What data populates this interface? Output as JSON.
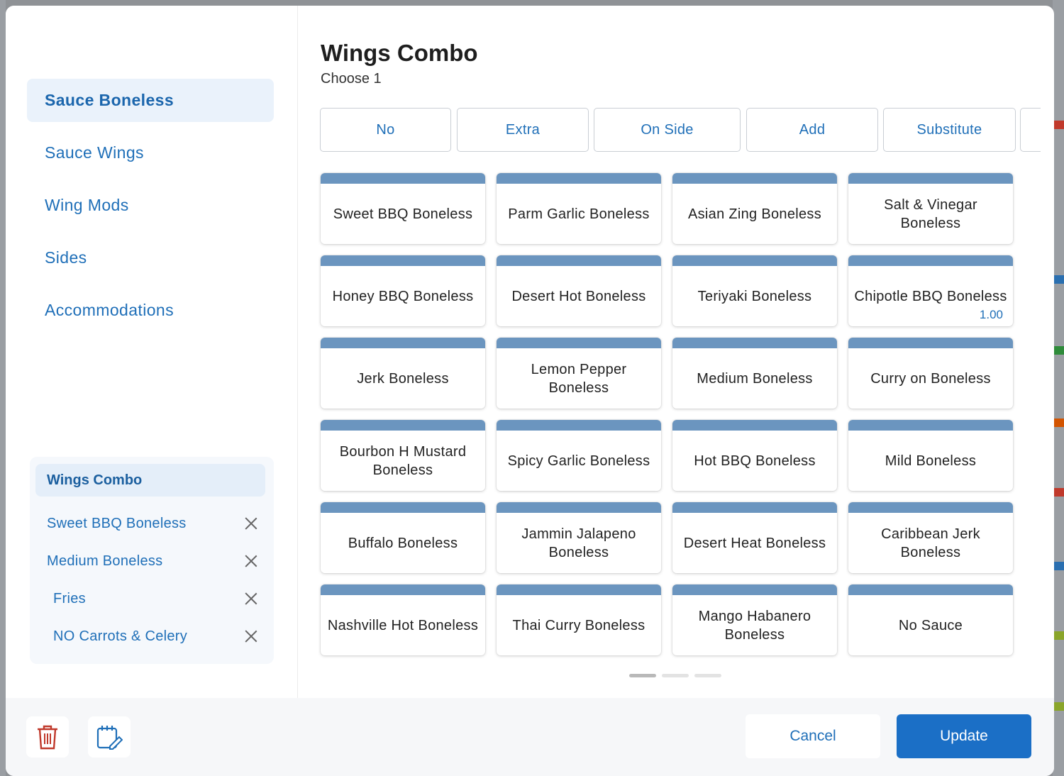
{
  "colors": {
    "accent": "#1f6fb8",
    "tile_bar": "#6b95bf",
    "update_button": "#1b6fc6",
    "delete_icon": "#c0392b"
  },
  "dialog": {
    "title": "Wings Combo",
    "subtitle": "Choose 1"
  },
  "sidebar": {
    "items": [
      {
        "label": "Sauce Boneless",
        "active": true
      },
      {
        "label": "Sauce Wings",
        "active": false
      },
      {
        "label": "Wing Mods",
        "active": false
      },
      {
        "label": "Sides",
        "active": false
      },
      {
        "label": "Accommodations",
        "active": false
      }
    ]
  },
  "summary": {
    "title": "Wings Combo",
    "items": [
      {
        "label": "Sweet BBQ Boneless"
      },
      {
        "label": "Medium Boneless"
      },
      {
        "label": "Fries"
      },
      {
        "label": "NO Carrots & Celery"
      }
    ]
  },
  "modifiers": [
    {
      "label": "No"
    },
    {
      "label": "Extra"
    },
    {
      "label": "On Side"
    },
    {
      "label": "Add"
    },
    {
      "label": "Substitute"
    },
    {
      "label": ""
    }
  ],
  "options": [
    {
      "label": "Sweet BBQ Boneless"
    },
    {
      "label": "Parm Garlic Boneless"
    },
    {
      "label": "Asian Zing Boneless"
    },
    {
      "label": "Salt & Vinegar Boneless"
    },
    {
      "label": "Honey BBQ Boneless"
    },
    {
      "label": "Desert Hot Boneless"
    },
    {
      "label": "Teriyaki Boneless"
    },
    {
      "label": "Chipotle BBQ Boneless",
      "price": "1.00"
    },
    {
      "label": "Jerk Boneless"
    },
    {
      "label": "Lemon Pepper Boneless"
    },
    {
      "label": "Medium Boneless"
    },
    {
      "label": "Curry on Boneless"
    },
    {
      "label": "Bourbon H Mustard Boneless"
    },
    {
      "label": "Spicy Garlic Boneless"
    },
    {
      "label": "Hot BBQ Boneless"
    },
    {
      "label": "Mild Boneless"
    },
    {
      "label": "Buffalo Boneless"
    },
    {
      "label": "Jammin Jalapeno Boneless"
    },
    {
      "label": "Desert Heat Boneless"
    },
    {
      "label": "Caribbean Jerk Boneless"
    },
    {
      "label": "Nashville Hot Boneless"
    },
    {
      "label": "Thai Curry Boneless"
    },
    {
      "label": "Mango Habanero Boneless"
    },
    {
      "label": "No Sauce"
    }
  ],
  "pager": {
    "pages": 3,
    "current": 1
  },
  "footer": {
    "delete_icon": "trash-icon",
    "notes_icon": "edit-note-icon",
    "cancel_label": "Cancel",
    "update_label": "Update"
  }
}
